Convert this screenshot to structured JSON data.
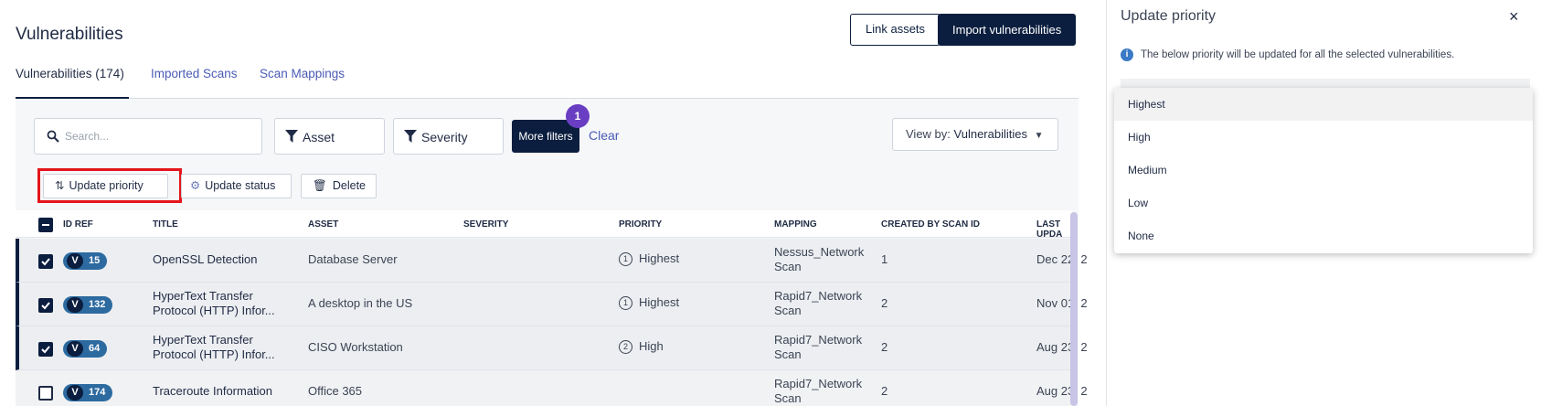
{
  "header": {
    "title": "Vulnerabilities",
    "link_assets": "Link assets",
    "import": "Import vulnerabilities"
  },
  "tabs": [
    {
      "label": "Vulnerabilities (174)"
    },
    {
      "label": "Imported Scans"
    },
    {
      "label": "Scan Mappings"
    }
  ],
  "filters": {
    "search_placeholder": "Search...",
    "asset": "Asset",
    "severity": "Severity",
    "more_filters": "More filters",
    "more_filters_count": "1",
    "clear": "Clear",
    "view_by_label": "View by:",
    "view_by_value": "Vulnerabilities"
  },
  "actions": {
    "update_priority": "Update priority",
    "update_status": "Update status",
    "delete": "Delete"
  },
  "columns": [
    "ID REF",
    "TITLE",
    "ASSET",
    "SEVERITY",
    "PRIORITY",
    "MAPPING",
    "CREATED BY SCAN ID",
    "LAST UPDA"
  ],
  "rows": [
    {
      "selected": true,
      "id_prefix": "V",
      "id": "15",
      "title1": "OpenSSL Detection",
      "title2": "",
      "asset": "Database Server",
      "prio_num": "1",
      "priority": "Highest",
      "map1": "Nessus_Network",
      "map2": "Scan",
      "scan_id": "1",
      "updated": "Dec 22, 2"
    },
    {
      "selected": true,
      "id_prefix": "V",
      "id": "132",
      "title1": "HyperText Transfer",
      "title2": "Protocol (HTTP) Infor...",
      "asset": "A desktop in the US",
      "prio_num": "1",
      "priority": "Highest",
      "map1": "Rapid7_Network",
      "map2": "Scan",
      "scan_id": "2",
      "updated": "Nov 01, 2"
    },
    {
      "selected": true,
      "id_prefix": "V",
      "id": "64",
      "title1": "HyperText Transfer",
      "title2": "Protocol (HTTP) Infor...",
      "asset": "CISO Workstation",
      "prio_num": "2",
      "priority": "High",
      "map1": "Rapid7_Network",
      "map2": "Scan",
      "scan_id": "2",
      "updated": "Aug 23, 2"
    },
    {
      "selected": false,
      "id_prefix": "V",
      "id": "174",
      "title1": "Traceroute Information",
      "title2": "",
      "asset": "Office 365",
      "prio_num": "",
      "priority": "",
      "map1": "Rapid7_Network",
      "map2": "Scan",
      "scan_id": "2",
      "updated": "Aug 23, 2"
    }
  ],
  "panel": {
    "title": "Update priority",
    "close": "×",
    "info": "The below priority will be updated for all the selected vulnerabilities.",
    "options": [
      "Highest",
      "High",
      "Medium",
      "Low",
      "None"
    ]
  },
  "colors": {
    "navy": "#0b1e3f",
    "link": "#4a5bb5",
    "badge": "#6a3ec2",
    "highlight": "#e3151a",
    "pill": "#2c6aa0"
  }
}
